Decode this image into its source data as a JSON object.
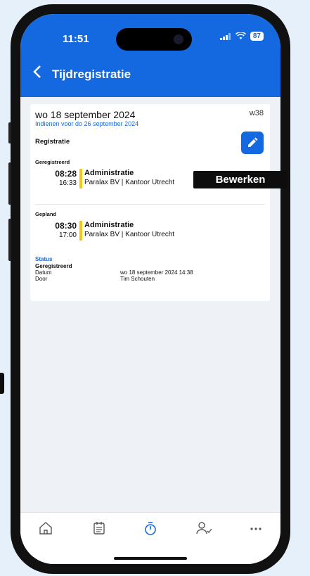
{
  "status_bar": {
    "time": "11:51",
    "battery": "87"
  },
  "header": {
    "title": "Tijdregistratie"
  },
  "card": {
    "date": "wo 18 september 2024",
    "week": "w38",
    "deadline": "Indienen voor do 26 september 2024",
    "registration_title": "Registratie",
    "registered": {
      "label": "Geregistreerd",
      "start": "08:28",
      "end": "16:33",
      "activity": "Administratie",
      "location": "Paralax BV | Kantoor Utrecht"
    },
    "planned": {
      "label": "Gepland",
      "start": "08:30",
      "end": "17:00",
      "activity": "Administratie",
      "location": "Paralax BV | Kantoor Utrecht"
    },
    "status": {
      "label": "Status",
      "value": "Geregistreerd",
      "date_label": "Datum",
      "date_value": "wo 18 september 2024 14:38",
      "by_label": "Door",
      "by_value": "Tim Schouten"
    }
  },
  "tooltip": {
    "text": "Bewerken"
  },
  "colors": {
    "primary": "#1569e0",
    "accent_bar": "#f5c518"
  },
  "icons": {
    "back": "chevron-left-icon",
    "edit": "pencil-icon",
    "tabs": [
      "home-icon",
      "calendar-icon",
      "timer-icon",
      "user-check-icon",
      "more-icon"
    ]
  }
}
